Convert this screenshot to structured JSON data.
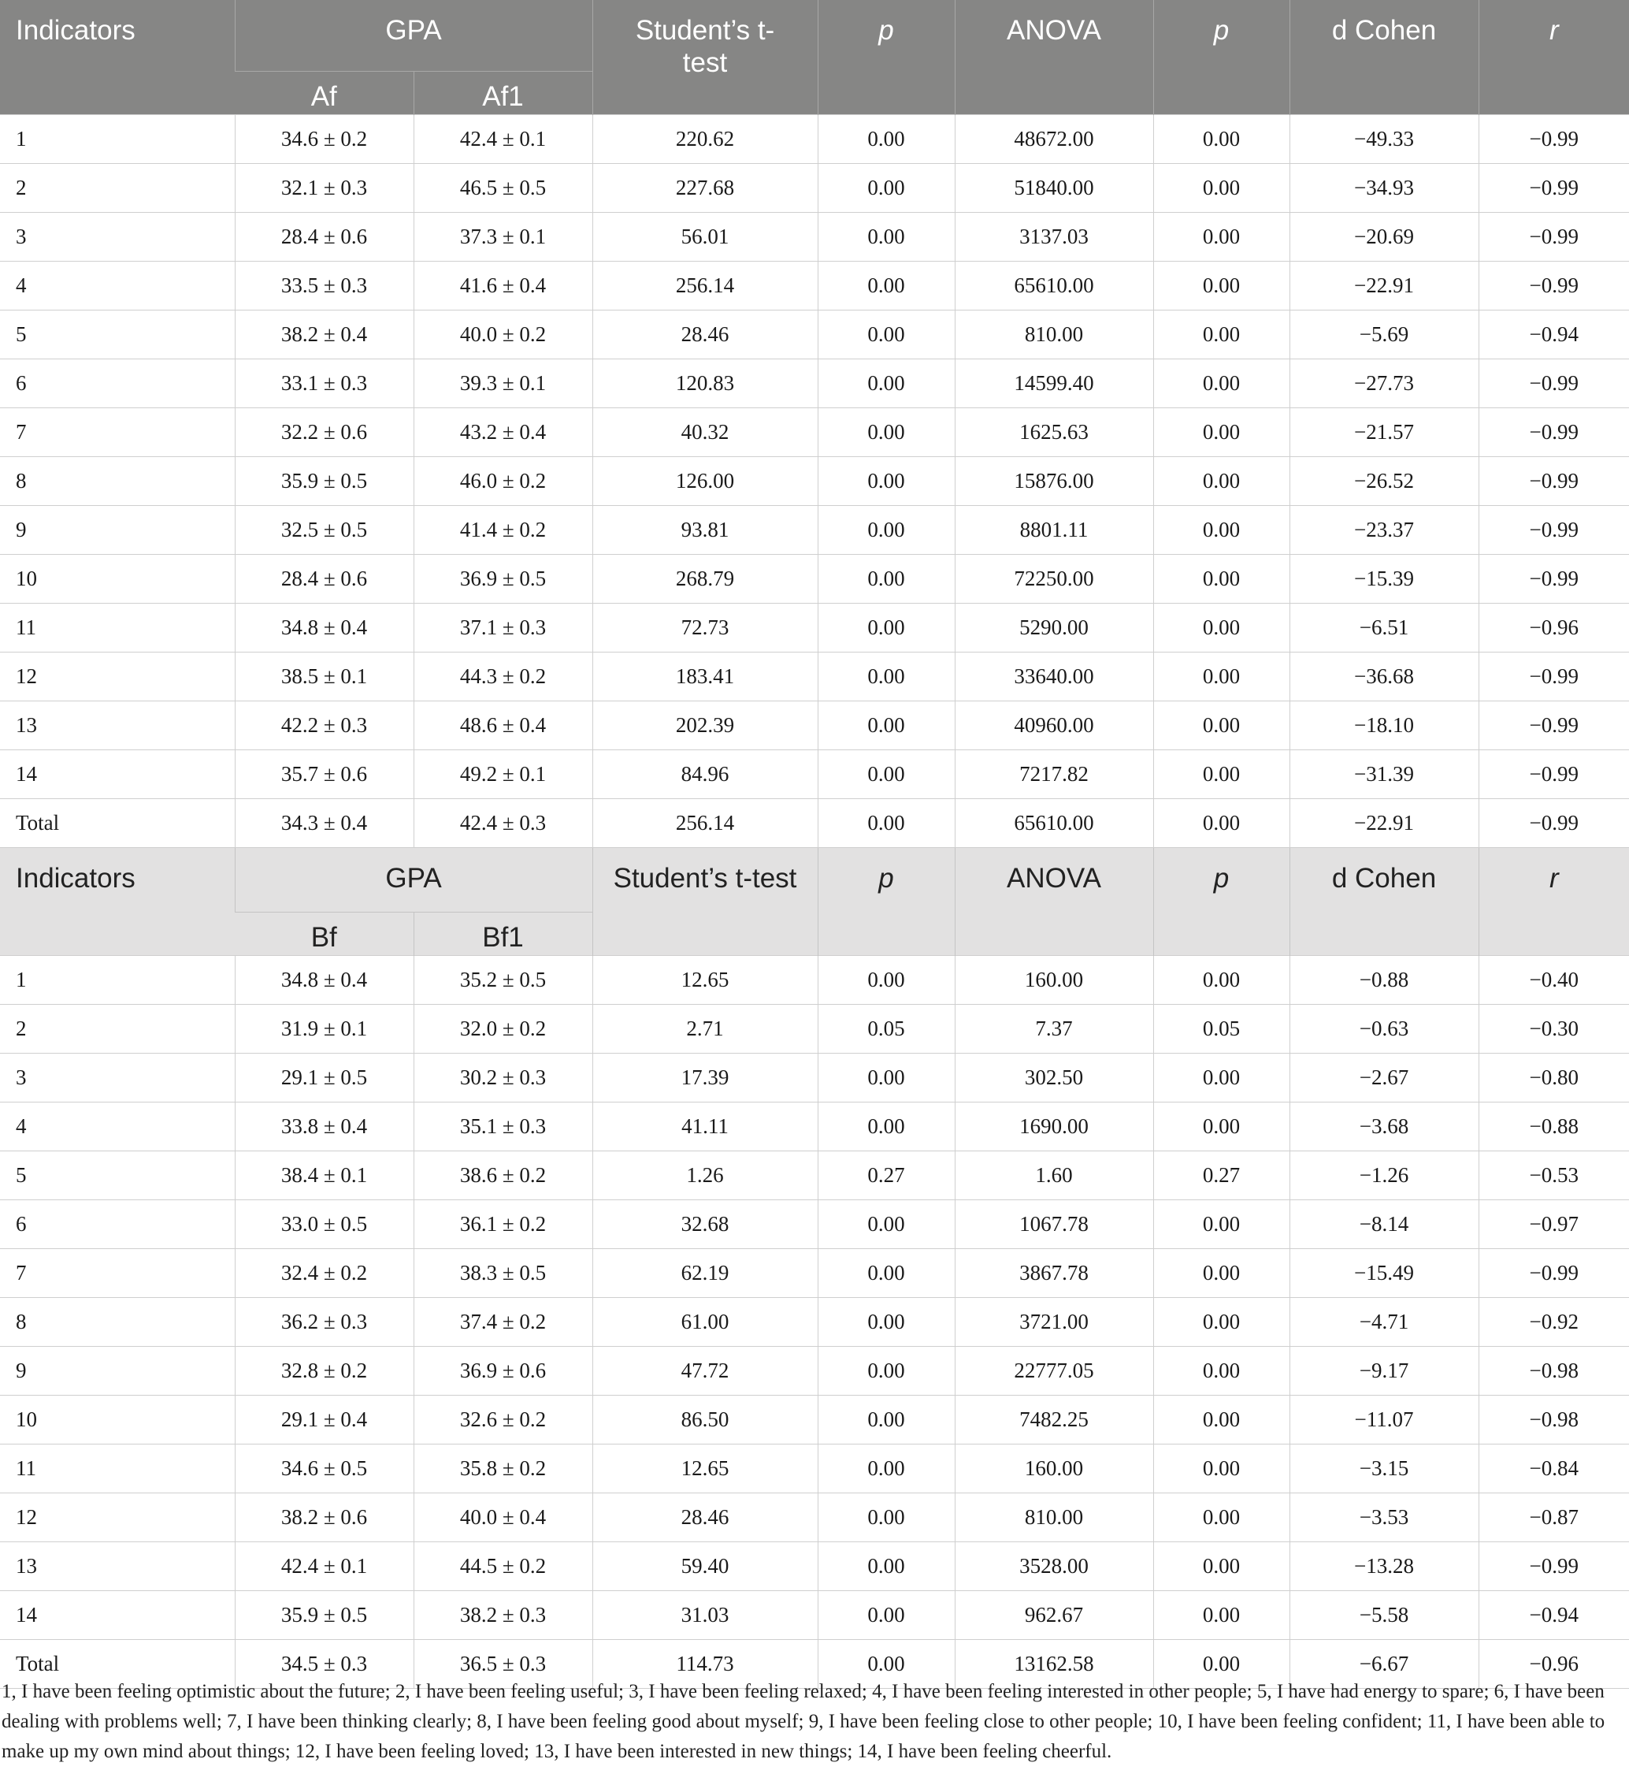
{
  "sectionA": {
    "header": {
      "indicators": "Indicators",
      "gpa": "GPA",
      "sub1": "Af",
      "sub2": "Af1",
      "ttest": "Student’s t-test",
      "p1": "p",
      "anova": "ANOVA",
      "p2": "p",
      "dcohen": "d Cohen",
      "r": "r"
    },
    "rows": [
      [
        "1",
        "34.6 ± 0.2",
        "42.4 ± 0.1",
        "220.62",
        "0.00",
        "48672.00",
        "0.00",
        "−49.33",
        "−0.99"
      ],
      [
        "2",
        "32.1 ± 0.3",
        "46.5 ± 0.5",
        "227.68",
        "0.00",
        "51840.00",
        "0.00",
        "−34.93",
        "−0.99"
      ],
      [
        "3",
        "28.4 ± 0.6",
        "37.3 ± 0.1",
        "56.01",
        "0.00",
        "3137.03",
        "0.00",
        "−20.69",
        "−0.99"
      ],
      [
        "4",
        "33.5 ± 0.3",
        "41.6 ± 0.4",
        "256.14",
        "0.00",
        "65610.00",
        "0.00",
        "−22.91",
        "−0.99"
      ],
      [
        "5",
        "38.2 ± 0.4",
        "40.0 ± 0.2",
        "28.46",
        "0.00",
        "810.00",
        "0.00",
        "−5.69",
        "−0.94"
      ],
      [
        "6",
        "33.1 ± 0.3",
        "39.3 ± 0.1",
        "120.83",
        "0.00",
        "14599.40",
        "0.00",
        "−27.73",
        "−0.99"
      ],
      [
        "7",
        "32.2 ± 0.6",
        "43.2 ± 0.4",
        "40.32",
        "0.00",
        "1625.63",
        "0.00",
        "−21.57",
        "−0.99"
      ],
      [
        "8",
        "35.9 ± 0.5",
        "46.0 ± 0.2",
        "126.00",
        "0.00",
        "15876.00",
        "0.00",
        "−26.52",
        "−0.99"
      ],
      [
        "9",
        "32.5 ± 0.5",
        "41.4 ± 0.2",
        "93.81",
        "0.00",
        "8801.11",
        "0.00",
        "−23.37",
        "−0.99"
      ],
      [
        "10",
        "28.4 ± 0.6",
        "36.9 ± 0.5",
        "268.79",
        "0.00",
        "72250.00",
        "0.00",
        "−15.39",
        "−0.99"
      ],
      [
        "11",
        "34.8 ± 0.4",
        "37.1 ± 0.3",
        "72.73",
        "0.00",
        "5290.00",
        "0.00",
        "−6.51",
        "−0.96"
      ],
      [
        "12",
        "38.5 ± 0.1",
        "44.3 ± 0.2",
        "183.41",
        "0.00",
        "33640.00",
        "0.00",
        "−36.68",
        "−0.99"
      ],
      [
        "13",
        "42.2 ± 0.3",
        "48.6 ± 0.4",
        "202.39",
        "0.00",
        "40960.00",
        "0.00",
        "−18.10",
        "−0.99"
      ],
      [
        "14",
        "35.7 ± 0.6",
        "49.2 ± 0.1",
        "84.96",
        "0.00",
        "7217.82",
        "0.00",
        "−31.39",
        "−0.99"
      ],
      [
        "Total",
        "34.3 ± 0.4",
        "42.4 ± 0.3",
        "256.14",
        "0.00",
        "65610.00",
        "0.00",
        "−22.91",
        "−0.99"
      ]
    ]
  },
  "sectionB": {
    "header": {
      "indicators": "Indicators",
      "gpa": "GPA",
      "sub1": "Bf",
      "sub2": "Bf1",
      "ttest": "Student’s t-test",
      "p1": "p",
      "anova": "ANOVA",
      "p2": "p",
      "dcohen": "d Cohen",
      "r": "r"
    },
    "rows": [
      [
        "1",
        "34.8 ± 0.4",
        "35.2 ± 0.5",
        "12.65",
        "0.00",
        "160.00",
        "0.00",
        "−0.88",
        "−0.40"
      ],
      [
        "2",
        "31.9 ± 0.1",
        "32.0 ± 0.2",
        "2.71",
        "0.05",
        "7.37",
        "0.05",
        "−0.63",
        "−0.30"
      ],
      [
        "3",
        "29.1 ± 0.5",
        "30.2 ± 0.3",
        "17.39",
        "0.00",
        "302.50",
        "0.00",
        "−2.67",
        "−0.80"
      ],
      [
        "4",
        "33.8 ± 0.4",
        "35.1 ± 0.3",
        "41.11",
        "0.00",
        "1690.00",
        "0.00",
        "−3.68",
        "−0.88"
      ],
      [
        "5",
        "38.4 ± 0.1",
        "38.6 ± 0.2",
        "1.26",
        "0.27",
        "1.60",
        "0.27",
        "−1.26",
        "−0.53"
      ],
      [
        "6",
        "33.0 ± 0.5",
        "36.1 ± 0.2",
        "32.68",
        "0.00",
        "1067.78",
        "0.00",
        "−8.14",
        "−0.97"
      ],
      [
        "7",
        "32.4 ± 0.2",
        "38.3 ± 0.5",
        "62.19",
        "0.00",
        "3867.78",
        "0.00",
        "−15.49",
        "−0.99"
      ],
      [
        "8",
        "36.2 ± 0.3",
        "37.4 ± 0.2",
        "61.00",
        "0.00",
        "3721.00",
        "0.00",
        "−4.71",
        "−0.92"
      ],
      [
        "9",
        "32.8 ± 0.2",
        "36.9 ± 0.6",
        "47.72",
        "0.00",
        "22777.05",
        "0.00",
        "−9.17",
        "−0.98"
      ],
      [
        "10",
        "29.1 ± 0.4",
        "32.6 ± 0.2",
        "86.50",
        "0.00",
        "7482.25",
        "0.00",
        "−11.07",
        "−0.98"
      ],
      [
        "11",
        "34.6 ± 0.5",
        "35.8 ± 0.2",
        "12.65",
        "0.00",
        "160.00",
        "0.00",
        "−3.15",
        "−0.84"
      ],
      [
        "12",
        "38.2 ± 0.6",
        "40.0 ± 0.4",
        "28.46",
        "0.00",
        "810.00",
        "0.00",
        "−3.53",
        "−0.87"
      ],
      [
        "13",
        "42.4 ± 0.1",
        "44.5 ± 0.2",
        "59.40",
        "0.00",
        "3528.00",
        "0.00",
        "−13.28",
        "−0.99"
      ],
      [
        "14",
        "35.9 ± 0.5",
        "38.2 ± 0.3",
        "31.03",
        "0.00",
        "962.67",
        "0.00",
        "−5.58",
        "−0.94"
      ],
      [
        "Total",
        "34.5 ± 0.3",
        "36.5 ± 0.3",
        "114.73",
        "0.00",
        "13162.58",
        "0.00",
        "−6.67",
        "−0.96"
      ]
    ]
  },
  "footnote": "1, I have been feeling optimistic about the future; 2, I have been feeling useful; 3, I have been feeling relaxed; 4, I have been feeling interested in other people; 5, I have had energy to spare; 6, I have been dealing with problems well; 7, I have been thinking clearly; 8, I have been feeling good about myself; 9, I have been feeling close to other people; 10, I have been feeling confident; 11, I have been able to make up my own mind about things; 12, I have been feeling loved; 13, I have been interested in new things; 14, I have been feeling cheerful."
}
